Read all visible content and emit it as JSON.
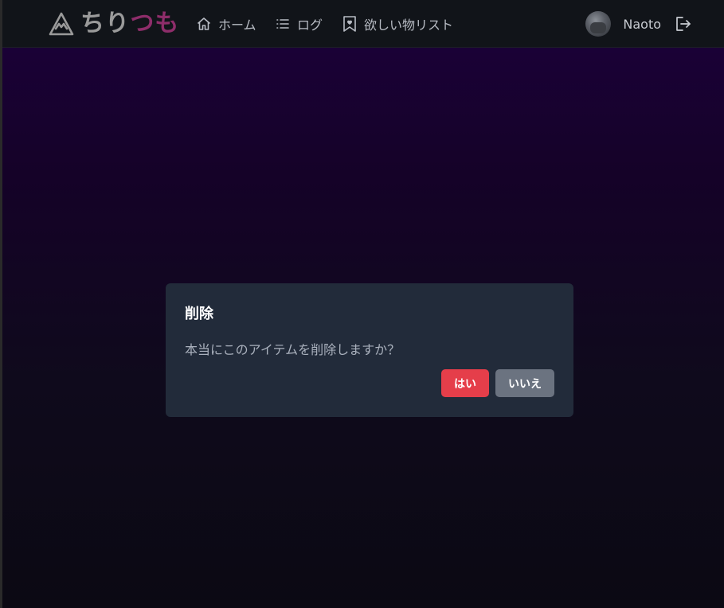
{
  "brand": {
    "part1": "ちり",
    "part2": "つも",
    "icon": "mountain-icon"
  },
  "nav": {
    "home": {
      "label": "ホーム",
      "icon": "home-icon"
    },
    "log": {
      "label": "ログ",
      "icon": "list-icon"
    },
    "wishlist": {
      "label": "欲しい物リスト",
      "icon": "bookmark-heart-icon"
    }
  },
  "user": {
    "name": "Naoto",
    "logout_icon": "logout-icon"
  },
  "dialog": {
    "title": "削除",
    "message": "本当にこのアイテムを削除しますか？",
    "yes_label": "はい",
    "no_label": "いいえ"
  },
  "colors": {
    "navbar_bg": "#111419",
    "dialog_bg": "#222b3a",
    "danger": "#e53e4a",
    "secondary": "#6b7380",
    "brand_accent": "#8e2d6a"
  }
}
